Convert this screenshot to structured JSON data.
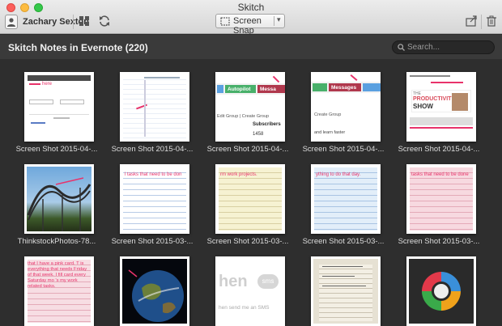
{
  "window": {
    "title": "Skitch"
  },
  "toolbar": {
    "user_name": "Zachary Sexton",
    "screen_snap_label": "Screen Snap",
    "icons": [
      "user-icon",
      "grid-view-icon",
      "sync-icon",
      "crop-icon",
      "share-icon",
      "trash-icon"
    ]
  },
  "header": {
    "title": "Skitch Notes in Evernote (220)",
    "search_placeholder": "Search..."
  },
  "notes": [
    {
      "caption": "Screen Shot 2015-04-..."
    },
    {
      "caption": "Screen Shot 2015-04-..."
    },
    {
      "caption": "Screen Shot 2015-04-..."
    },
    {
      "caption": "Screen Shot 2015-04-..."
    },
    {
      "caption": "Screen Shot 2015-04-..."
    },
    {
      "caption": "ThinkstockPhotos-78..."
    },
    {
      "caption": "Screen Shot 2015-03-..."
    },
    {
      "caption": "Screen Shot 2015-03-..."
    },
    {
      "caption": "Screen Shot 2015-03-..."
    },
    {
      "caption": "Screen Shot 2015-03-..."
    },
    {
      "caption": ""
    },
    {
      "caption": ""
    },
    {
      "caption": ""
    },
    {
      "caption": ""
    },
    {
      "caption": ""
    }
  ],
  "thumb_text": {
    "t1_label": "here",
    "t3_tab1": "Autopilot",
    "t3_tab2": "Messa",
    "t3_line1": "Edit Group | Create Group",
    "t3_line2": "Subscribers",
    "t3_line3": "1458",
    "t4_tab1": "Messages",
    "t4_line1": "Create Group",
    "t4_line2": "and learn faster",
    "t5_show1": "THE",
    "t5_show2": "PRODUCTIVITY",
    "t5_show3": "SHOW",
    "t7_text": "l tasks that need to be don",
    "t8_text": "rm work projects.",
    "t9_text": "ything to do that day.",
    "t10_text": "tasks that need to be done",
    "t11_text": "that I have a pink card. T is everything that needs Friday of that week. I fill card every Saturday mo 's my work related tasks.",
    "t13_word": "hen",
    "t13_bubble": "sms",
    "t13_line": "hen send me an SMS"
  }
}
